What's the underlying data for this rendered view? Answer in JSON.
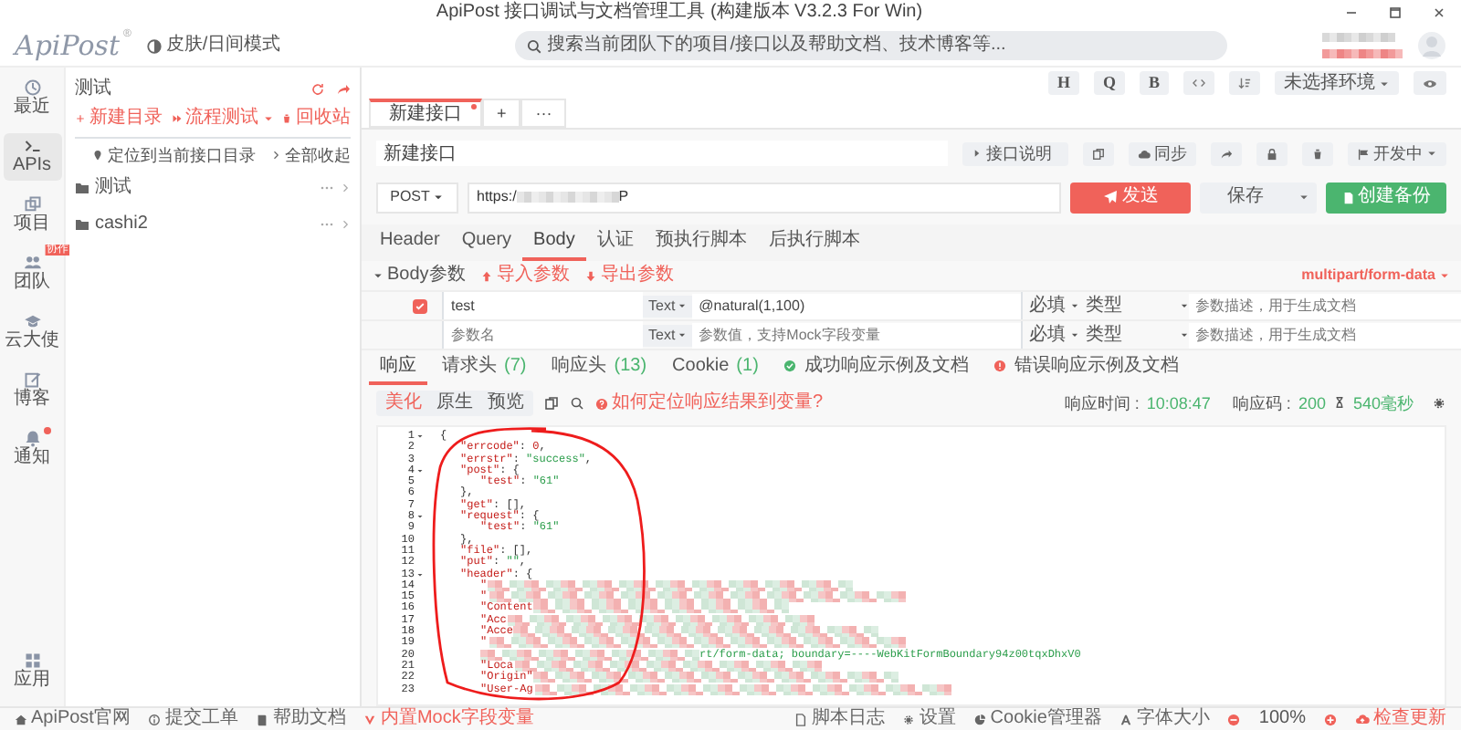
{
  "window": {
    "title": "ApiPost 接口调试与文档管理工具 (构建版本 V3.2.3 For Win)"
  },
  "header": {
    "logo": "ApiPost",
    "logo_mark": "®",
    "theme_toggle": "皮肤/日间模式",
    "search": {
      "placeholder": "搜索当前团队下的项目/接口以及帮助文档、技术博客等..."
    }
  },
  "nav": [
    {
      "label": "最近",
      "selected": false,
      "unread": false
    },
    {
      "label": "APIs",
      "selected": true,
      "unread": false
    },
    {
      "label": "项目",
      "selected": false,
      "unread": false
    },
    {
      "label": "团队",
      "selected": false,
      "unread": false,
      "badge": "协作"
    },
    {
      "label": "云大使",
      "selected": false,
      "unread": false
    },
    {
      "label": "博客",
      "selected": false,
      "unread": false
    },
    {
      "label": "通知",
      "selected": false,
      "unread": true
    },
    {
      "label": "应用",
      "selected": false,
      "unread": false
    }
  ],
  "tree": {
    "project": "测试",
    "actions": [
      {
        "label": "新建目录",
        "menu": false
      },
      {
        "label": "流程测试",
        "menu": true
      },
      {
        "label": "回收站",
        "menu": false
      }
    ],
    "locate": "定位到当前接口目录",
    "collapse_all": "全部收起",
    "folders": [
      {
        "label": "测试"
      },
      {
        "label": "cashi2"
      }
    ]
  },
  "toolbar": {
    "format_buttons": [
      "H",
      "Q",
      "B"
    ],
    "environment": "未选择环境"
  },
  "tabs": [
    {
      "label": "新建接口",
      "selected": true,
      "unsaved": true
    }
  ],
  "tab_add": "+",
  "tab_more": "···",
  "request": {
    "name": "新建接口",
    "doc_button": "接口说明",
    "sync_button": "同步",
    "status": "开发中",
    "method": "POST",
    "url_start": "https:/",
    "url_end": "P",
    "send": "发送",
    "save": "保存",
    "backup": "创建备份",
    "tabs": [
      {
        "label": "Header",
        "selected": false
      },
      {
        "label": "Query",
        "selected": false
      },
      {
        "label": "Body",
        "selected": true
      },
      {
        "label": "认证",
        "selected": false
      },
      {
        "label": "预执行脚本",
        "selected": false
      },
      {
        "label": "后执行脚本",
        "selected": false
      }
    ]
  },
  "body": {
    "title": "Body参数",
    "expanded": true,
    "import": "导入参数",
    "export": "导出参数",
    "content_type": "multipart/form-data",
    "params": [
      {
        "kind": "param",
        "checked": true,
        "name": "test",
        "type": "Text",
        "value": "@natural(1,100)",
        "required": "必填",
        "field_type": "类型",
        "description_placeholder": "参数描述，用于生成文档"
      },
      {
        "kind": "new",
        "name_placeholder": "参数名",
        "type": "Text",
        "value_placeholder": "参数值，支持Mock字段变量",
        "required": "必填",
        "field_type": "类型",
        "description_placeholder": "参数描述，用于生成文档"
      }
    ]
  },
  "response": {
    "tabs": [
      {
        "label": "响应",
        "selected": true,
        "kind": "plain"
      },
      {
        "label": "请求头",
        "count": "(7)",
        "selected": false,
        "kind": "plain"
      },
      {
        "label": "响应头",
        "count": "(13)",
        "selected": false,
        "kind": "plain"
      },
      {
        "label": "Cookie",
        "count": "(1)",
        "selected": false,
        "kind": "plain"
      },
      {
        "label": "成功响应示例及文档",
        "selected": false,
        "kind": "success"
      },
      {
        "label": "错误响应示例及文档",
        "selected": false,
        "kind": "error"
      }
    ],
    "views": [
      {
        "label": "美化",
        "selected": true
      },
      {
        "label": "原生",
        "selected": false
      },
      {
        "label": "预览",
        "selected": false
      }
    ],
    "help": "如何定位响应结果到变量?",
    "time_label": "响应时间 :",
    "time": "10:08:47",
    "code_label": "响应码 :",
    "code": "200",
    "duration": "540毫秒",
    "lines": [
      {
        "num": "1",
        "foldable": true,
        "parts": [
          {
            "p": "{"
          }
        ],
        "children": [
          {
            "num": "2",
            "foldable": false,
            "parts": [
              {
                "k": "\"errcode\""
              },
              {
                "p": ": "
              },
              {
                "n": "0"
              },
              {
                "p": ","
              }
            ]
          },
          {
            "num": "3",
            "foldable": false,
            "parts": [
              {
                "k": "\"errstr\""
              },
              {
                "p": ": "
              },
              {
                "s": "\"success\""
              },
              {
                "p": ","
              }
            ]
          },
          {
            "num": "4",
            "foldable": true,
            "parts": [
              {
                "k": "\"post\""
              },
              {
                "p": ": {"
              }
            ],
            "children": [
              {
                "num": "5",
                "foldable": false,
                "parts": [
                  {
                    "k": "\"test\""
                  },
                  {
                    "p": ": "
                  },
                  {
                    "s": "\"61\""
                  }
                ]
              }
            ]
          },
          {
            "num": "6",
            "foldable": false,
            "parts": [
              {
                "p": "},"
              }
            ]
          },
          {
            "num": "7",
            "foldable": false,
            "parts": [
              {
                "k": "\"get\""
              },
              {
                "p": ": [],"
              }
            ]
          },
          {
            "num": "8",
            "foldable": true,
            "parts": [
              {
                "k": "\"request\""
              },
              {
                "p": ": {"
              }
            ],
            "children": [
              {
                "num": "9",
                "foldable": false,
                "parts": [
                  {
                    "k": "\"test\""
                  },
                  {
                    "p": ": "
                  },
                  {
                    "s": "\"61\""
                  }
                ]
              }
            ]
          },
          {
            "num": "10",
            "foldable": false,
            "parts": [
              {
                "p": "},"
              }
            ]
          },
          {
            "num": "11",
            "foldable": false,
            "parts": [
              {
                "k": "\"file\""
              },
              {
                "p": ": [],"
              }
            ]
          },
          {
            "num": "12",
            "foldable": false,
            "parts": [
              {
                "k": "\"put\""
              },
              {
                "p": ": "
              },
              {
                "s": "\"\""
              },
              {
                "p": ","
              }
            ]
          },
          {
            "num": "13",
            "foldable": true,
            "parts": [
              {
                "k": "\"header\""
              },
              {
                "p": ": {"
              }
            ],
            "children": [
              {
                "num": "14",
                "foldable": false,
                "parts": [
                  {
                    "k": "\""
                  },
                  {
                    "blur": true
                  }
                ]
              },
              {
                "num": "15",
                "foldable": false,
                "parts": [
                  {
                    "k": "\""
                  },
                  {
                    "blur": true
                  }
                ]
              },
              {
                "num": "16",
                "foldable": false,
                "parts": [
                  {
                    "k": "\"Content"
                  },
                  {
                    "blur": true
                  }
                ]
              },
              {
                "num": "17",
                "foldable": false,
                "parts": [
                  {
                    "k": "\"Acc"
                  },
                  {
                    "blur": true
                  }
                ]
              },
              {
                "num": "18",
                "foldable": false,
                "parts": [
                  {
                    "k": "\"Acce"
                  },
                  {
                    "blur": true
                  }
                ]
              },
              {
                "num": "19",
                "foldable": false,
                "parts": [
                  {
                    "k": "\""
                  },
                  {
                    "blur": true
                  }
                ]
              },
              {
                "num": "20",
                "foldable": false,
                "parts": [
                  {
                    "blur": true
                  },
                  {
                    "s": "rt/form-data; boundary=----WebKitFormBoundary94z00tqxDhxV0"
                  }
                ]
              },
              {
                "num": "21",
                "foldable": false,
                "parts": [
                  {
                    "k": "\"Loca"
                  },
                  {
                    "blur": true
                  }
                ]
              },
              {
                "num": "22",
                "foldable": false,
                "parts": [
                  {
                    "k": "\"Origin\""
                  },
                  {
                    "blur": true
                  }
                ]
              },
              {
                "num": "23",
                "foldable": false,
                "parts": [
                  {
                    "k": "\"User-Ag"
                  },
                  {
                    "blur": true
                  }
                ]
              }
            ]
          }
        ]
      }
    ],
    "annotation": {
      "kind": "freehand-circle"
    }
  },
  "footer": {
    "left": [
      {
        "label": "ApiPost官网",
        "color": "#666666"
      },
      {
        "label": "提交工单",
        "color": "#666666"
      },
      {
        "label": "帮助文档",
        "color": "#666666"
      },
      {
        "label": "内置Mock字段变量",
        "color": "#f0625a"
      }
    ],
    "right": [
      {
        "label": "脚本日志",
        "color": "#666666"
      },
      {
        "label": "设置",
        "color": "#666666"
      },
      {
        "label": "Cookie管理器",
        "color": "#666666"
      },
      {
        "label": "字体大小",
        "color": "#666666"
      }
    ],
    "zoom": "100%",
    "update": {
      "label": "检查更新",
      "color": "#f0625a"
    }
  }
}
